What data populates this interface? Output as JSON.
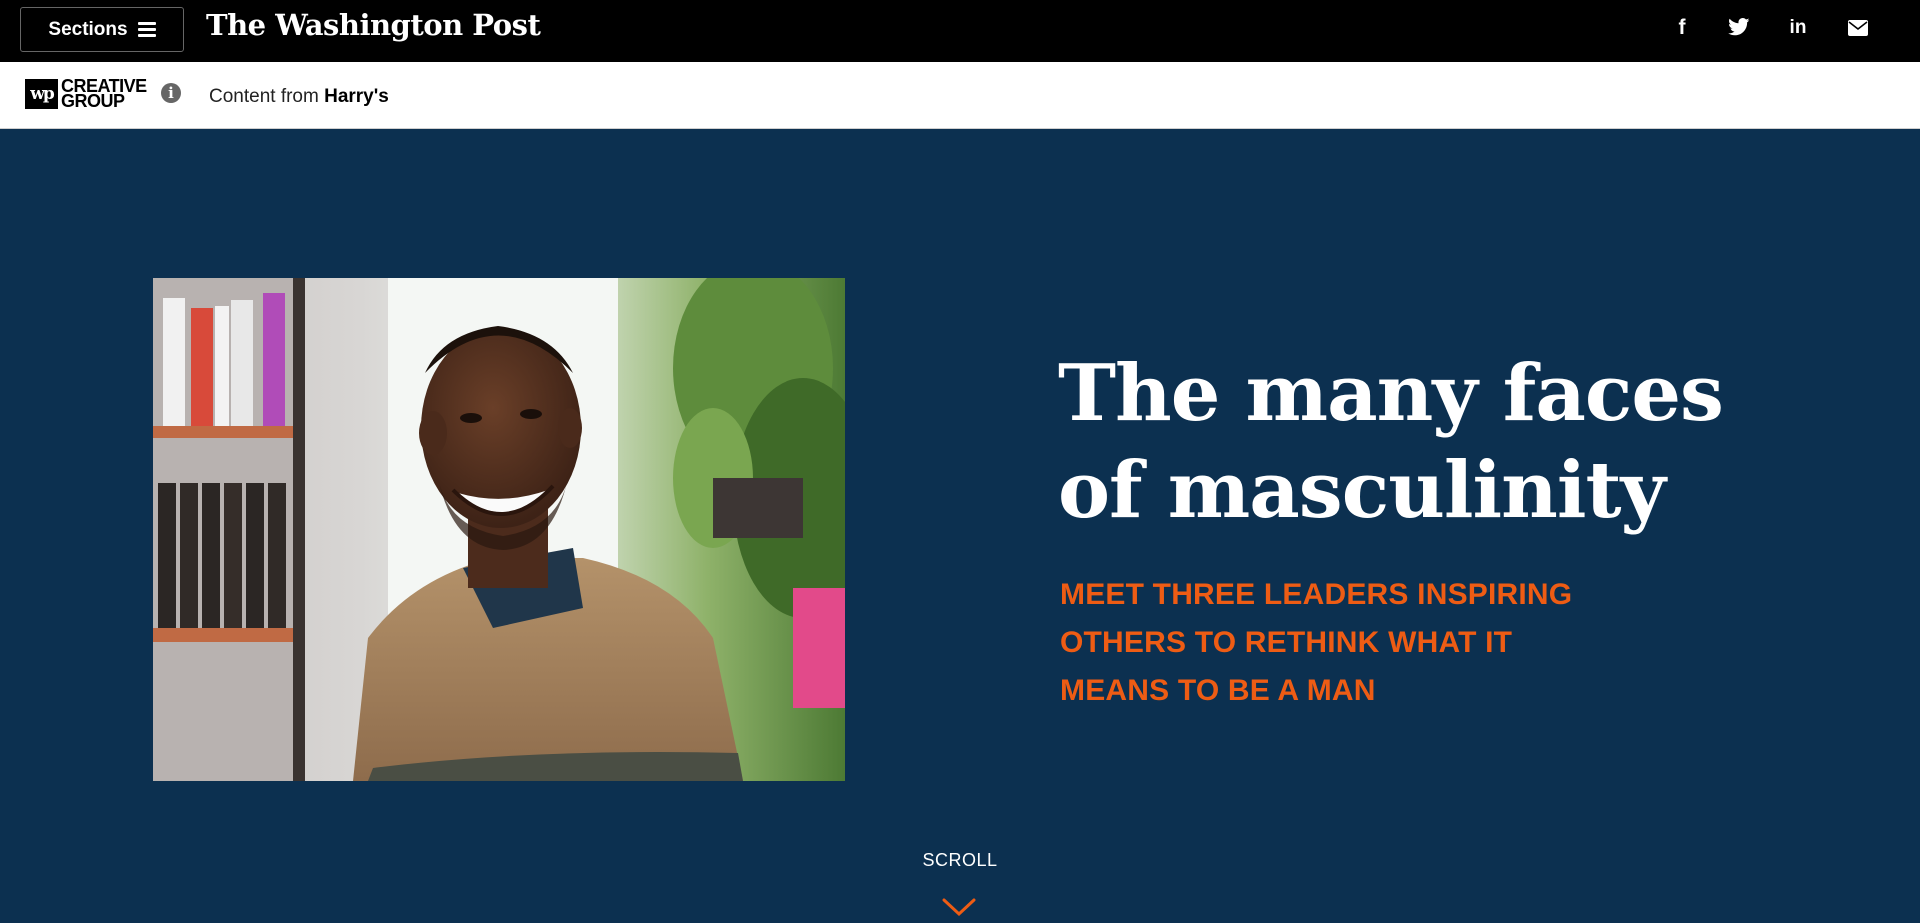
{
  "header": {
    "sections_label": "Sections",
    "logo_text": "The Washington Post",
    "social": {
      "facebook_glyph": "f",
      "linkedin_glyph": "in"
    },
    "icons": [
      "menu-icon",
      "facebook-icon",
      "twitter-icon",
      "linkedin-icon",
      "email-icon"
    ]
  },
  "sponsor": {
    "logo_mark": "wp",
    "logo_line1": "CREATIVE",
    "logo_line2": "GROUP",
    "info_glyph": "i",
    "prefix": "Content from ",
    "brand": "Harry's"
  },
  "hero": {
    "headline": "The many faces of masculinity",
    "subhead": "MEET THREE LEADERS INSPIRING OTHERS TO RETHINK WHAT IT MEANS TO BE A MAN",
    "scroll_label": "SCROLL"
  },
  "colors": {
    "topbar": "#000000",
    "hero_background": "#0c3050",
    "accent_orange": "#ee5c14",
    "headline": "#ffffff"
  }
}
